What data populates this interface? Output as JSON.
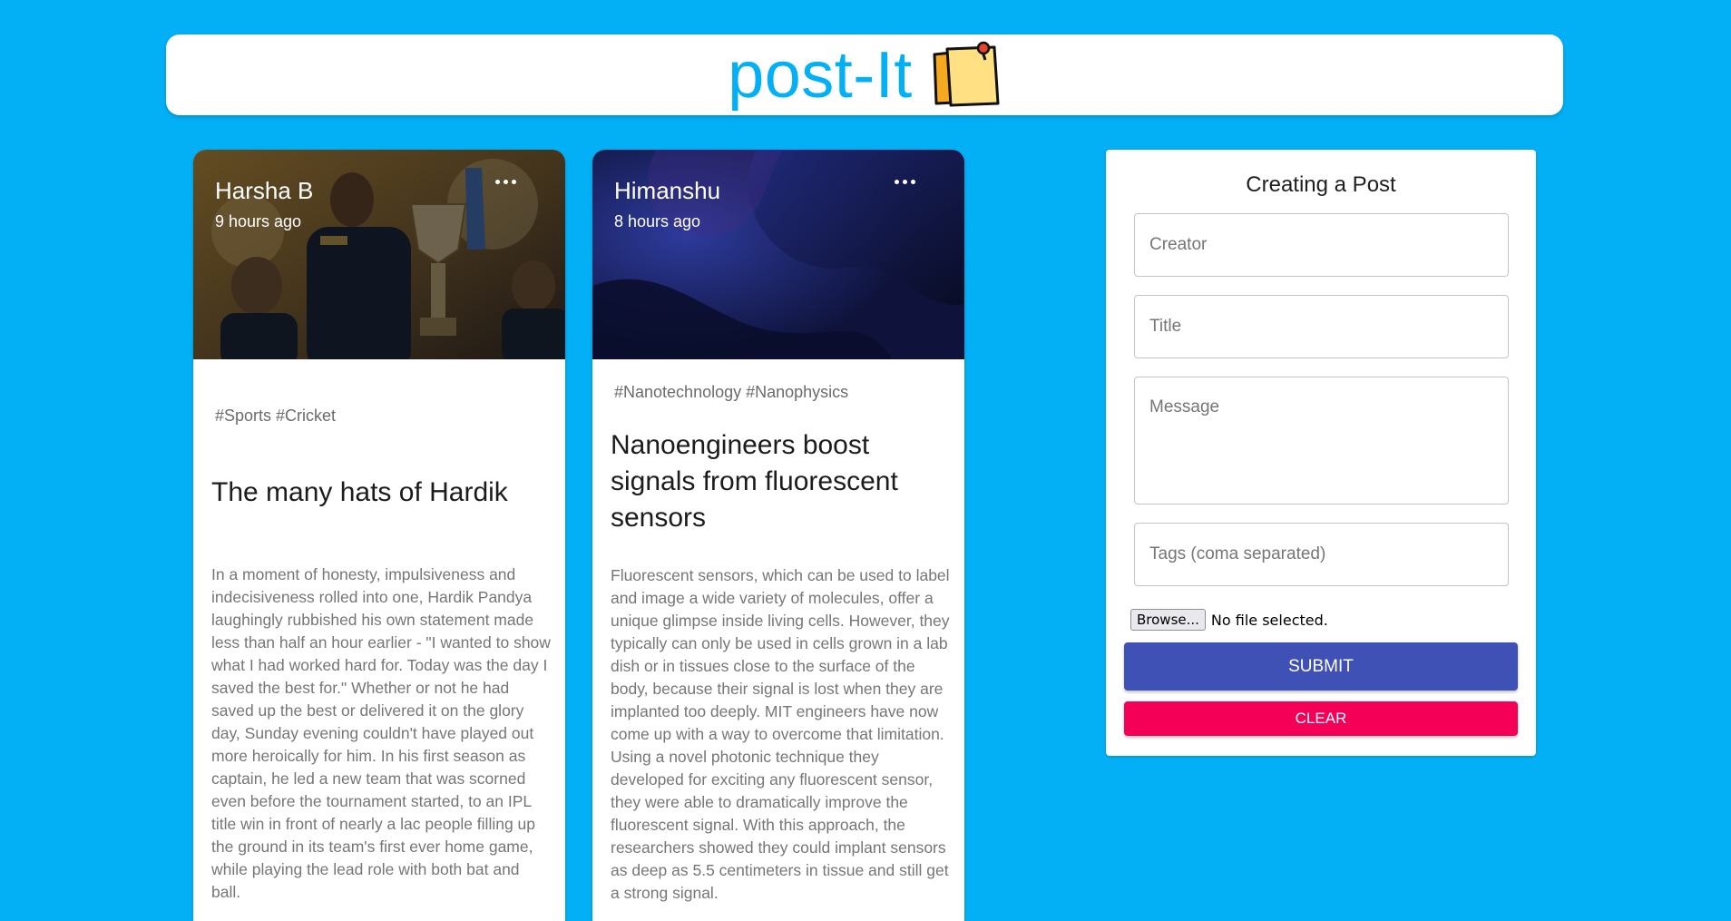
{
  "app": {
    "brand": "post-It",
    "brand_icon": "sticky-note-pin-icon"
  },
  "posts": [
    {
      "creator": "Harsha B",
      "time": "9 hours ago",
      "tags": "#Sports #Cricket",
      "title": "The many hats of Hardik",
      "message": "In a moment of honesty, impulsiveness and indecisiveness rolled into one, Hardik Pandya laughingly rubbished his own statement made less than half an hour earlier - \"I wanted to show what I had worked hard for. Today was the day I saved the best for.\" Whether or not he had saved up the best or delivered it on the glory day, Sunday evening couldn't have played out more heroically for him. In his first season as captain, he led a new team that was scorned even before the tournament started, to an IPL title win in front of nearly a lac people filling up the ground in its team's first ever home game, while playing the lead role with both bat and ball.",
      "image": "cricket-trophy-photo"
    },
    {
      "creator": "Himanshu",
      "time": "8 hours ago",
      "tags": "#Nanotechnology #Nanophysics",
      "title": "Nanoengineers boost signals from fluorescent sensors",
      "message": "Fluorescent sensors, which can be used to label and image a wide variety of molecules, offer a unique glimpse inside living cells. However, they typically can only be used in cells grown in a lab dish or in tissues close to the surface of the body, because their signal is lost when they are implanted too deeply. MIT engineers have now come up with a way to overcome that limitation. Using a novel photonic technique they developed for exciting any fluorescent sensor, they were able to dramatically improve the fluorescent signal. With this approach, the researchers showed they could implant sensors as deep as 5.5 centimeters in tissue and still get a strong signal.",
      "image": "abstract-blue-waves"
    }
  ],
  "form": {
    "heading": "Creating a Post",
    "creator_placeholder": "Creator",
    "title_placeholder": "Title",
    "message_placeholder": "Message",
    "tags_placeholder": "Tags (coma separated)",
    "browse_label": "Browse...",
    "file_status": "No file selected.",
    "submit_label": "SUBMIT",
    "clear_label": "CLEAR"
  },
  "colors": {
    "background": "#03b0f5",
    "brand": "#03b0f5",
    "submit": "#3f51b5",
    "clear": "#f50057"
  }
}
